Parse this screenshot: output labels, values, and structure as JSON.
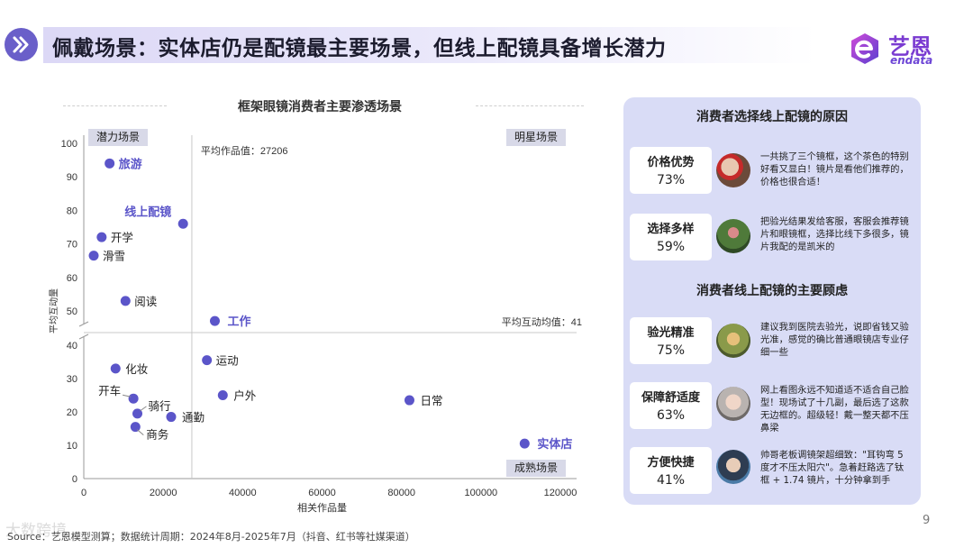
{
  "header": {
    "title": "佩戴场景：实体店仍是配镜最主要场景，但线上配镜具备增长潜力",
    "logo_cn": "艺恩",
    "logo_en": "endata"
  },
  "chart_data": {
    "type": "scatter",
    "title": "框架眼镜消费者主要渗透场景",
    "xlabel": "相关作品量",
    "ylabel": "平均互动量",
    "xlim": [
      0,
      120000
    ],
    "xticks": [
      0,
      20000,
      40000,
      60000,
      80000,
      100000,
      120000
    ],
    "ybreak": {
      "lower": [
        0,
        43
      ],
      "upper": [
        42,
        100
      ]
    },
    "yticks_lower": [
      0,
      10,
      20,
      30,
      40
    ],
    "yticks_upper": [
      50,
      60,
      70,
      80,
      90,
      100
    ],
    "ref_x": {
      "value": 27206,
      "label": "平均作品值：27206"
    },
    "ref_y": {
      "value": 41,
      "label": "平均互动均值：41"
    },
    "quadrants": {
      "top_left": "潜力场景",
      "top_right": "明星场景",
      "bottom_right": "成熟场景"
    },
    "point_color": "#5b55c9",
    "highlight_color": "#5b55c9",
    "points": [
      {
        "label": "旅游",
        "x": 6500,
        "y": 94,
        "highlight": true
      },
      {
        "label": "线上配镜",
        "x": 25000,
        "y": 76,
        "highlight": true
      },
      {
        "label": "开学",
        "x": 4500,
        "y": 72,
        "highlight": false
      },
      {
        "label": "滑雪",
        "x": 2500,
        "y": 66.5,
        "highlight": false
      },
      {
        "label": "阅读",
        "x": 10500,
        "y": 53,
        "highlight": false
      },
      {
        "label": "工作",
        "x": 33000,
        "y": 47,
        "highlight": true
      },
      {
        "label": "运动",
        "x": 31000,
        "y": 35.5,
        "highlight": false
      },
      {
        "label": "化妆",
        "x": 8000,
        "y": 33,
        "highlight": false
      },
      {
        "label": "户外",
        "x": 35000,
        "y": 25,
        "highlight": false
      },
      {
        "label": "日常",
        "x": 82000,
        "y": 23.5,
        "highlight": false
      },
      {
        "label": "开车",
        "x": 12500,
        "y": 24,
        "highlight": false
      },
      {
        "label": "骑行",
        "x": 13500,
        "y": 19.5,
        "highlight": false
      },
      {
        "label": "通勤",
        "x": 22000,
        "y": 18.5,
        "highlight": false
      },
      {
        "label": "商务",
        "x": 13000,
        "y": 15.5,
        "highlight": false
      },
      {
        "label": "实体店",
        "x": 111000,
        "y": 10.5,
        "highlight": true
      }
    ]
  },
  "source": "Source：艺恩模型测算；数据统计周期：2024年8月-2025年7月（抖音、红书等社媒渠道）",
  "watermark": "大数跨境",
  "page_number": "9",
  "panel": {
    "reasons_title": "消费者选择线上配镜的原因",
    "concerns_title": "消费者线上配镜的主要顾虑",
    "reasons": [
      {
        "label": "价格优势",
        "percent": "73%",
        "quote": "一共挑了三个镜框，这个茶色的特别好看又显白！镜片是看他们推荐的，价格也很合适！"
      },
      {
        "label": "选择多样",
        "percent": "59%",
        "quote": "把验光结果发给客服，客服会推荐镜片和眼镜框，选择比线下多很多，镜片我配的是凯米的"
      }
    ],
    "concerns": [
      {
        "label": "验光精准",
        "percent": "75%",
        "quote": "建议我到医院去验光，说即省钱又验光准，感觉的确比普通眼镜店专业仔细一些"
      },
      {
        "label": "保障舒适度",
        "percent": "63%",
        "quote": "网上看图永远不知道适不适合自己脸型！现场试了十几副，最后选了这款无边框的。超级轻！戴一整天都不压鼻梁"
      },
      {
        "label": "方便快捷",
        "percent": "41%",
        "quote": "帅哥老板调镜架超细致：\"耳钩弯 5 度才不压太阳穴\"。急着赶路选了钛框 + 1.74 镜片，十分钟拿到手"
      }
    ]
  }
}
